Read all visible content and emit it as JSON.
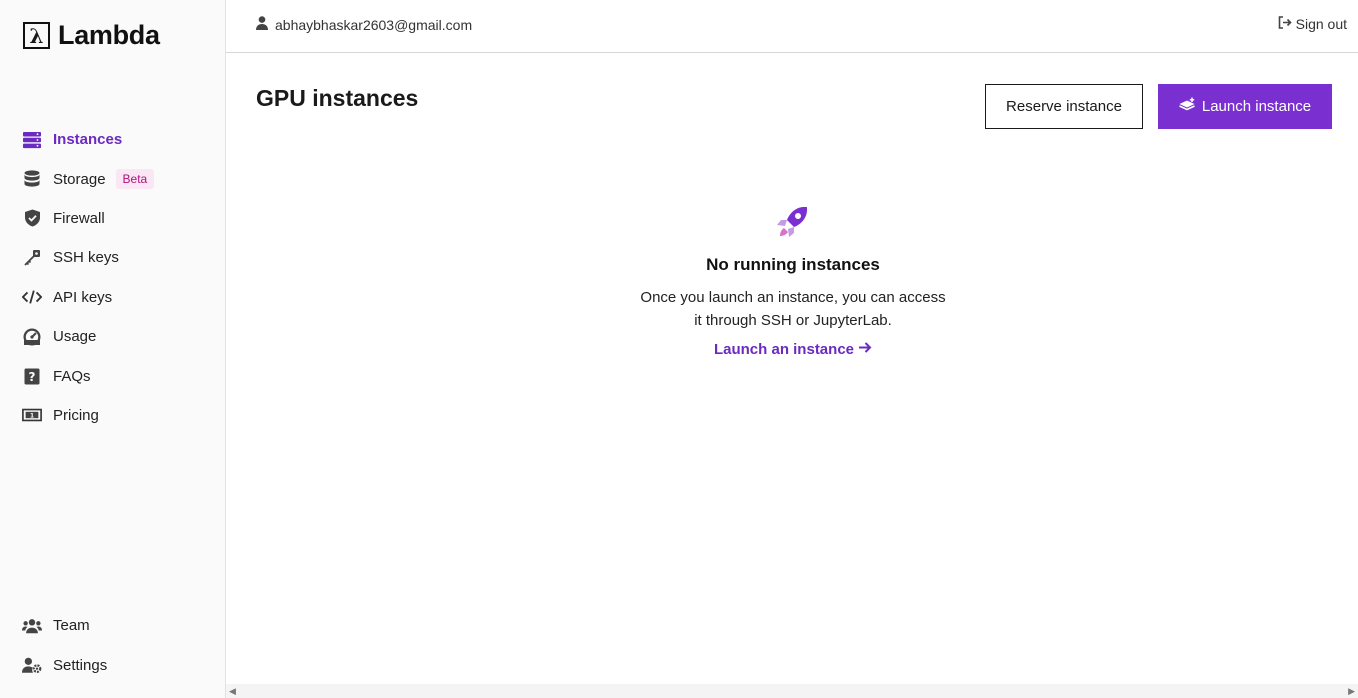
{
  "brand": {
    "logo_glyph": "λ",
    "name": "Lambda"
  },
  "colors": {
    "accent": "#7a2fd0",
    "beta_bg": "#fbe6f4",
    "beta_fg": "#b0127e"
  },
  "sidebar": {
    "items": [
      {
        "label": "Instances",
        "icon": "server-stack-icon",
        "active": true
      },
      {
        "label": "Storage",
        "icon": "database-icon",
        "badge": "Beta"
      },
      {
        "label": "Firewall",
        "icon": "shield-icon"
      },
      {
        "label": "SSH keys",
        "icon": "key-icon"
      },
      {
        "label": "API keys",
        "icon": "code-icon"
      },
      {
        "label": "Usage",
        "icon": "gauge-icon"
      },
      {
        "label": "FAQs",
        "icon": "question-icon"
      },
      {
        "label": "Pricing",
        "icon": "banknote-icon"
      }
    ],
    "bottom": [
      {
        "label": "Team",
        "icon": "users-icon"
      },
      {
        "label": "Settings",
        "icon": "user-gear-icon"
      }
    ]
  },
  "topbar": {
    "email": "abhaybhaskar2603@gmail.com",
    "sign_out": "Sign out"
  },
  "main": {
    "title": "GPU instances",
    "reserve_label": "Reserve instance",
    "launch_label": "Launch instance",
    "empty": {
      "title": "No running instances",
      "line1": "Once you launch an instance, you can access",
      "line2": "it through SSH or JupyterLab.",
      "link": "Launch an instance"
    }
  }
}
